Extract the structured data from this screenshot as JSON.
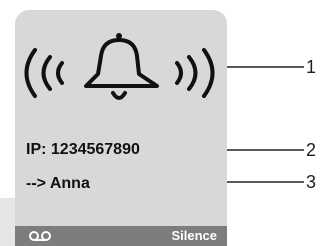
{
  "display": {
    "ring_icon": "ringing-bell-icon",
    "ip_line": "IP: 1234567890",
    "caller_line": "--> Anna",
    "softkeys": {
      "left_icon": "voicemail-icon",
      "right_label": "Silence"
    }
  },
  "callouts": [
    "1",
    "2",
    "3"
  ],
  "colors": {
    "screen_bg": "#d8d8d8",
    "softkey_bar": "#7d7d7d",
    "text": "#111111",
    "softkey_text": "#ffffff"
  }
}
